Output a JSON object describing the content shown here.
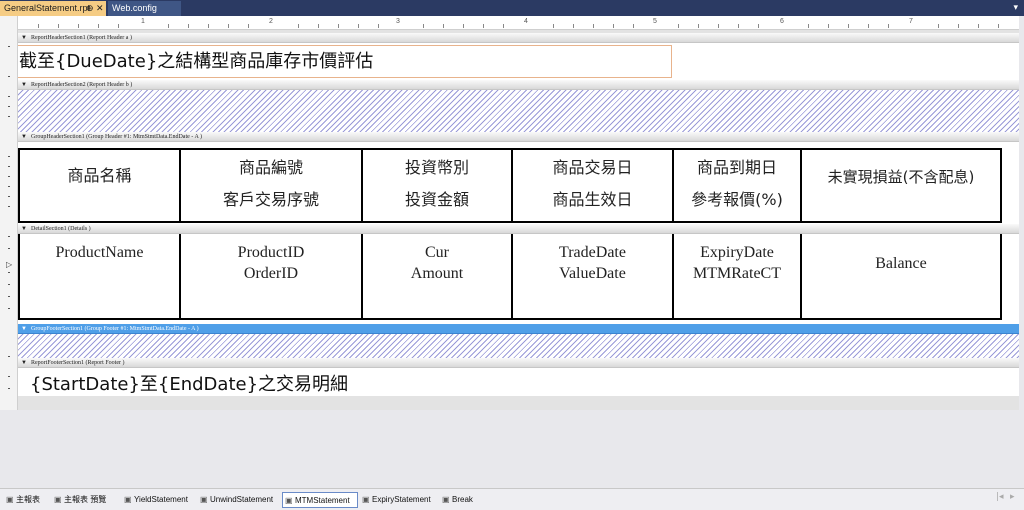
{
  "tabs": {
    "active": {
      "label": "GeneralStatement.rpt",
      "pin_icon": "pin-icon",
      "close_icon": "close-icon"
    },
    "inactive": {
      "label": "Web.config"
    }
  },
  "ruler": {
    "labels": [
      "1",
      "2",
      "3",
      "4",
      "5",
      "6",
      "7"
    ]
  },
  "sections": {
    "report_header_a": "ReportHeaderSection1 (Report Header a )",
    "report_header_b": "ReportHeaderSection2 (Report Header b )",
    "group_header": "GroupHeaderSection1 (Group Header #1: MtmStmtData.EndDate - A )",
    "details": "DetailSection1 (Details )",
    "group_footer": "GroupFooterSection1 (Group Footer #1: MtmStmtData.EndDate - A )",
    "report_footer": "ReportFooterSection1 (Report Footer )"
  },
  "report": {
    "title": "截至{DueDate}之結構型商品庫存市價評估",
    "footer_title": "{StartDate}至{EndDate}之交易明細"
  },
  "headers": [
    {
      "line1": "商品名稱",
      "line2": ""
    },
    {
      "line1": "商品編號",
      "line2": "客戶交易序號"
    },
    {
      "line1": "投資幣別",
      "line2": "投資金額"
    },
    {
      "line1": "商品交易日",
      "line2": "商品生效日"
    },
    {
      "line1": "商品到期日",
      "line2": "參考報價(%)"
    },
    {
      "line1": "未實現損益(不含配息)",
      "line2": ""
    }
  ],
  "details": [
    {
      "line1": "ProductName",
      "line2": ""
    },
    {
      "line1": "ProductID",
      "line2": "OrderID"
    },
    {
      "line1": "Cur",
      "line2": "Amount"
    },
    {
      "line1": "TradeDate",
      "line2": "ValueDate"
    },
    {
      "line1": "ExpiryDate",
      "line2": "MTMRateCT"
    },
    {
      "line1": "Balance",
      "line2": ""
    }
  ],
  "bottom_tabs": [
    {
      "label": "主報表",
      "icon": "report-icon",
      "active": false
    },
    {
      "label": "主報表 預覽",
      "icon": "report-icon",
      "active": false
    },
    {
      "label": "YieldStatement",
      "icon": "report-icon",
      "active": false
    },
    {
      "label": "UnwindStatement",
      "icon": "report-icon",
      "active": false
    },
    {
      "label": "MTMStatement",
      "icon": "report-icon",
      "active": true
    },
    {
      "label": "ExpiryStatement",
      "icon": "report-icon",
      "active": false
    },
    {
      "label": "Break",
      "icon": "report-icon",
      "active": false
    }
  ],
  "colors": {
    "tab_active": "#f5cc84",
    "tab_bar": "#2b3a63",
    "selected_section": "#4f9fe8"
  }
}
